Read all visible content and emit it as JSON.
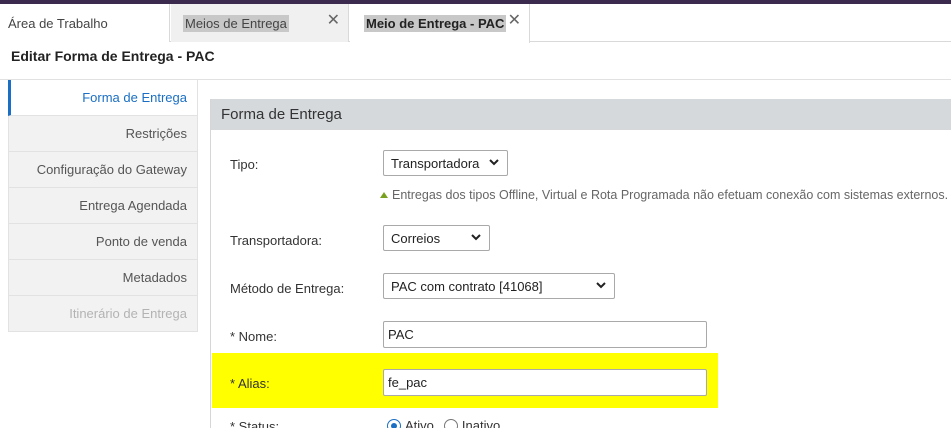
{
  "tabs": [
    {
      "label": "Área de Trabalho"
    },
    {
      "label": "Meios de Entrega"
    },
    {
      "label": "Meio de Entrega - PAC"
    }
  ],
  "page_title": "Editar Forma de Entrega - PAC",
  "sidebar": {
    "items": [
      {
        "label": "Forma de Entrega",
        "state": "active"
      },
      {
        "label": "Restrições",
        "state": "normal"
      },
      {
        "label": "Configuração do Gateway",
        "state": "normal"
      },
      {
        "label": "Entrega Agendada",
        "state": "normal"
      },
      {
        "label": "Ponto de venda",
        "state": "normal"
      },
      {
        "label": "Metadados",
        "state": "normal"
      },
      {
        "label": "Itinerário de Entrega",
        "state": "disabled"
      }
    ]
  },
  "panel": {
    "title": "Forma de Entrega"
  },
  "form": {
    "tipo": {
      "label": "Tipo:",
      "value": "Transportadora"
    },
    "hint": "Entregas dos tipos Offline, Virtual e Rota Programada não efetuam conexão com sistemas externos.",
    "transportadora": {
      "label": "Transportadora:",
      "value": "Correios"
    },
    "metodo": {
      "label": "Método de Entrega:",
      "value": "PAC com contrato [41068]"
    },
    "nome": {
      "label": "* Nome:",
      "value": "PAC"
    },
    "alias": {
      "label": "* Alias:",
      "value": "fe_pac"
    },
    "status": {
      "label": "* Status:",
      "options": [
        "Ativo",
        "Inativo"
      ],
      "selected": "Ativo"
    }
  },
  "colors": {
    "accent": "#1a6fc4",
    "highlight": "#ffff00",
    "panel_header": "#d6d9dc"
  },
  "icons": {
    "close": "close-icon",
    "chevron": "chevron-down-icon",
    "hint": "triangle-up-icon"
  }
}
